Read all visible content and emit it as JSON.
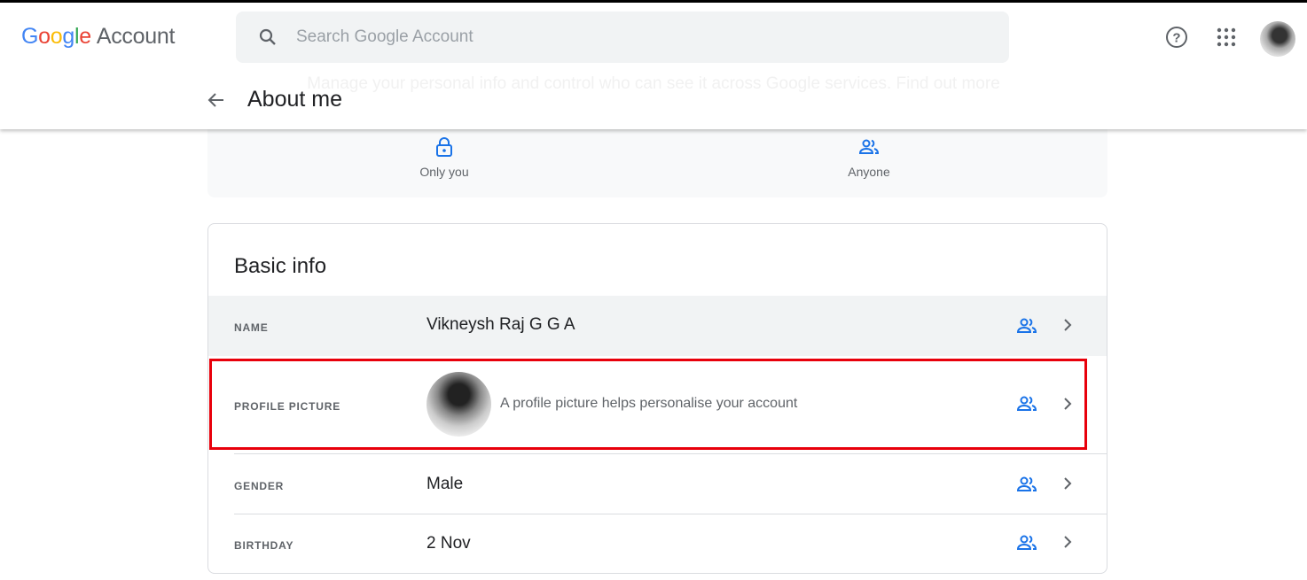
{
  "header": {
    "logo_google": "Google",
    "logo_account": "Account",
    "search_placeholder": "Search Google Account",
    "faded_text": "Manage your personal info and control who can see it across Google services. Find out more",
    "page_title": "About me"
  },
  "visibility": {
    "only_you": "Only you",
    "anyone": "Anyone"
  },
  "basic_info": {
    "title": "Basic info",
    "rows": [
      {
        "label": "NAME",
        "value": "Vikneysh Raj G G A"
      },
      {
        "label": "PROFILE PICTURE",
        "value": "A profile picture helps personalise your account"
      },
      {
        "label": "GENDER",
        "value": "Male"
      },
      {
        "label": "BIRTHDAY",
        "value": "2 Nov"
      }
    ]
  },
  "colors": {
    "accent": "#1a73e8",
    "highlight": "#e8000b"
  }
}
